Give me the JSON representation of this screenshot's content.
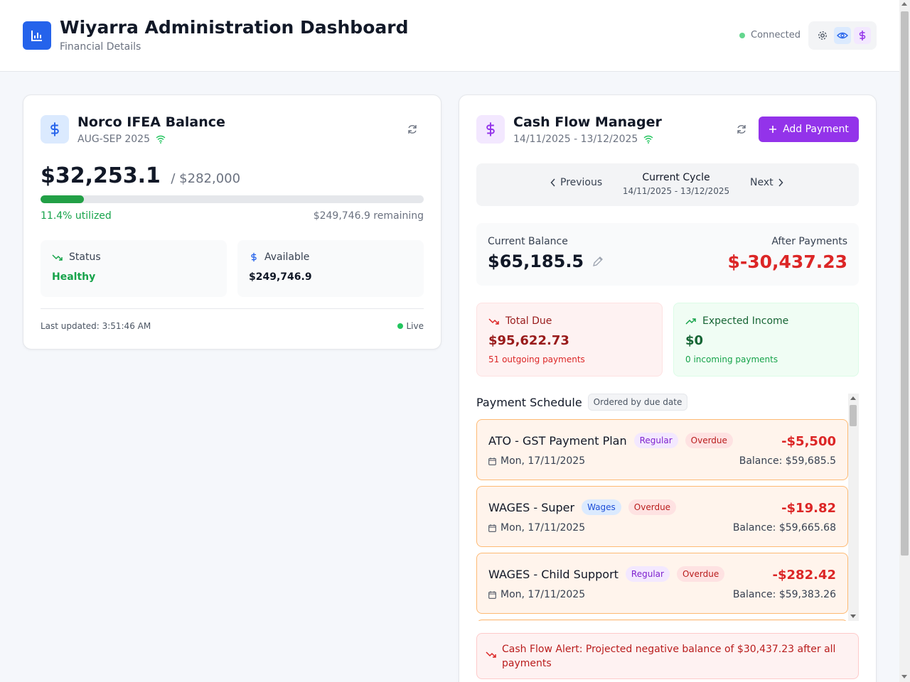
{
  "header": {
    "title": "Wiyarra Administration Dashboard",
    "subtitle": "Financial Details",
    "status": "Connected"
  },
  "balance_card": {
    "title": "Norco IFEA Balance",
    "period": "AUG-SEP 2025",
    "amount": "$32,253.1",
    "limit": "/ $282,000",
    "utilized_fraction": 0.114,
    "utilized_label": "11.4% utilized",
    "remaining_label": "$249,746.9 remaining",
    "status_label": "Status",
    "status_value": "Healthy",
    "available_label": "Available",
    "available_value": "$249,746.9",
    "last_updated": "Last updated: 3:51:46 AM",
    "live_label": "Live"
  },
  "cashflow": {
    "title": "Cash Flow Manager",
    "range": "14/11/2025 - 13/12/2025",
    "add_payment_label": "Add Payment",
    "prev_label": "Previous",
    "next_label": "Next",
    "cycle_title": "Current Cycle",
    "cycle_range": "14/11/2025 - 13/12/2025",
    "current_balance_label": "Current Balance",
    "current_balance": "$65,185.5",
    "after_payments_label": "After Payments",
    "after_payments": "$-30,437.23",
    "total_due_label": "Total Due",
    "total_due": "$95,622.73",
    "total_due_note": "51 outgoing payments",
    "expected_income_label": "Expected Income",
    "expected_income": "$0",
    "expected_income_note": "0 incoming payments",
    "schedule_title": "Payment Schedule",
    "schedule_order": "Ordered by due date",
    "payments": [
      {
        "name": "ATO - GST Payment Plan",
        "type": "Regular",
        "status": "Overdue",
        "date": "Mon, 17/11/2025",
        "amount": "-$5,500",
        "balance": "Balance: $59,685.5"
      },
      {
        "name": "WAGES - Super",
        "type": "Wages",
        "status": "Overdue",
        "date": "Mon, 17/11/2025",
        "amount": "-$19.82",
        "balance": "Balance: $59,665.68"
      },
      {
        "name": "WAGES - Child Support",
        "type": "Regular",
        "status": "Overdue",
        "date": "Mon, 17/11/2025",
        "amount": "-$282.42",
        "balance": "Balance: $59,383.26"
      }
    ],
    "alert": "Cash Flow Alert: Projected negative balance of $30,437.23 after all payments"
  },
  "colors": {
    "brand_blue": "#2563eb",
    "accent_purple": "#9333ea",
    "success_green": "#16a34a",
    "danger_red": "#dc2626"
  },
  "icons": [
    "bar-chart-icon",
    "gear-icon",
    "eye-icon",
    "dollar-icon",
    "refresh-icon",
    "wifi-icon",
    "trending-down-icon",
    "trending-up-icon",
    "pencil-icon",
    "calendar-icon",
    "chevron-left-icon",
    "chevron-right-icon",
    "plus-icon"
  ]
}
